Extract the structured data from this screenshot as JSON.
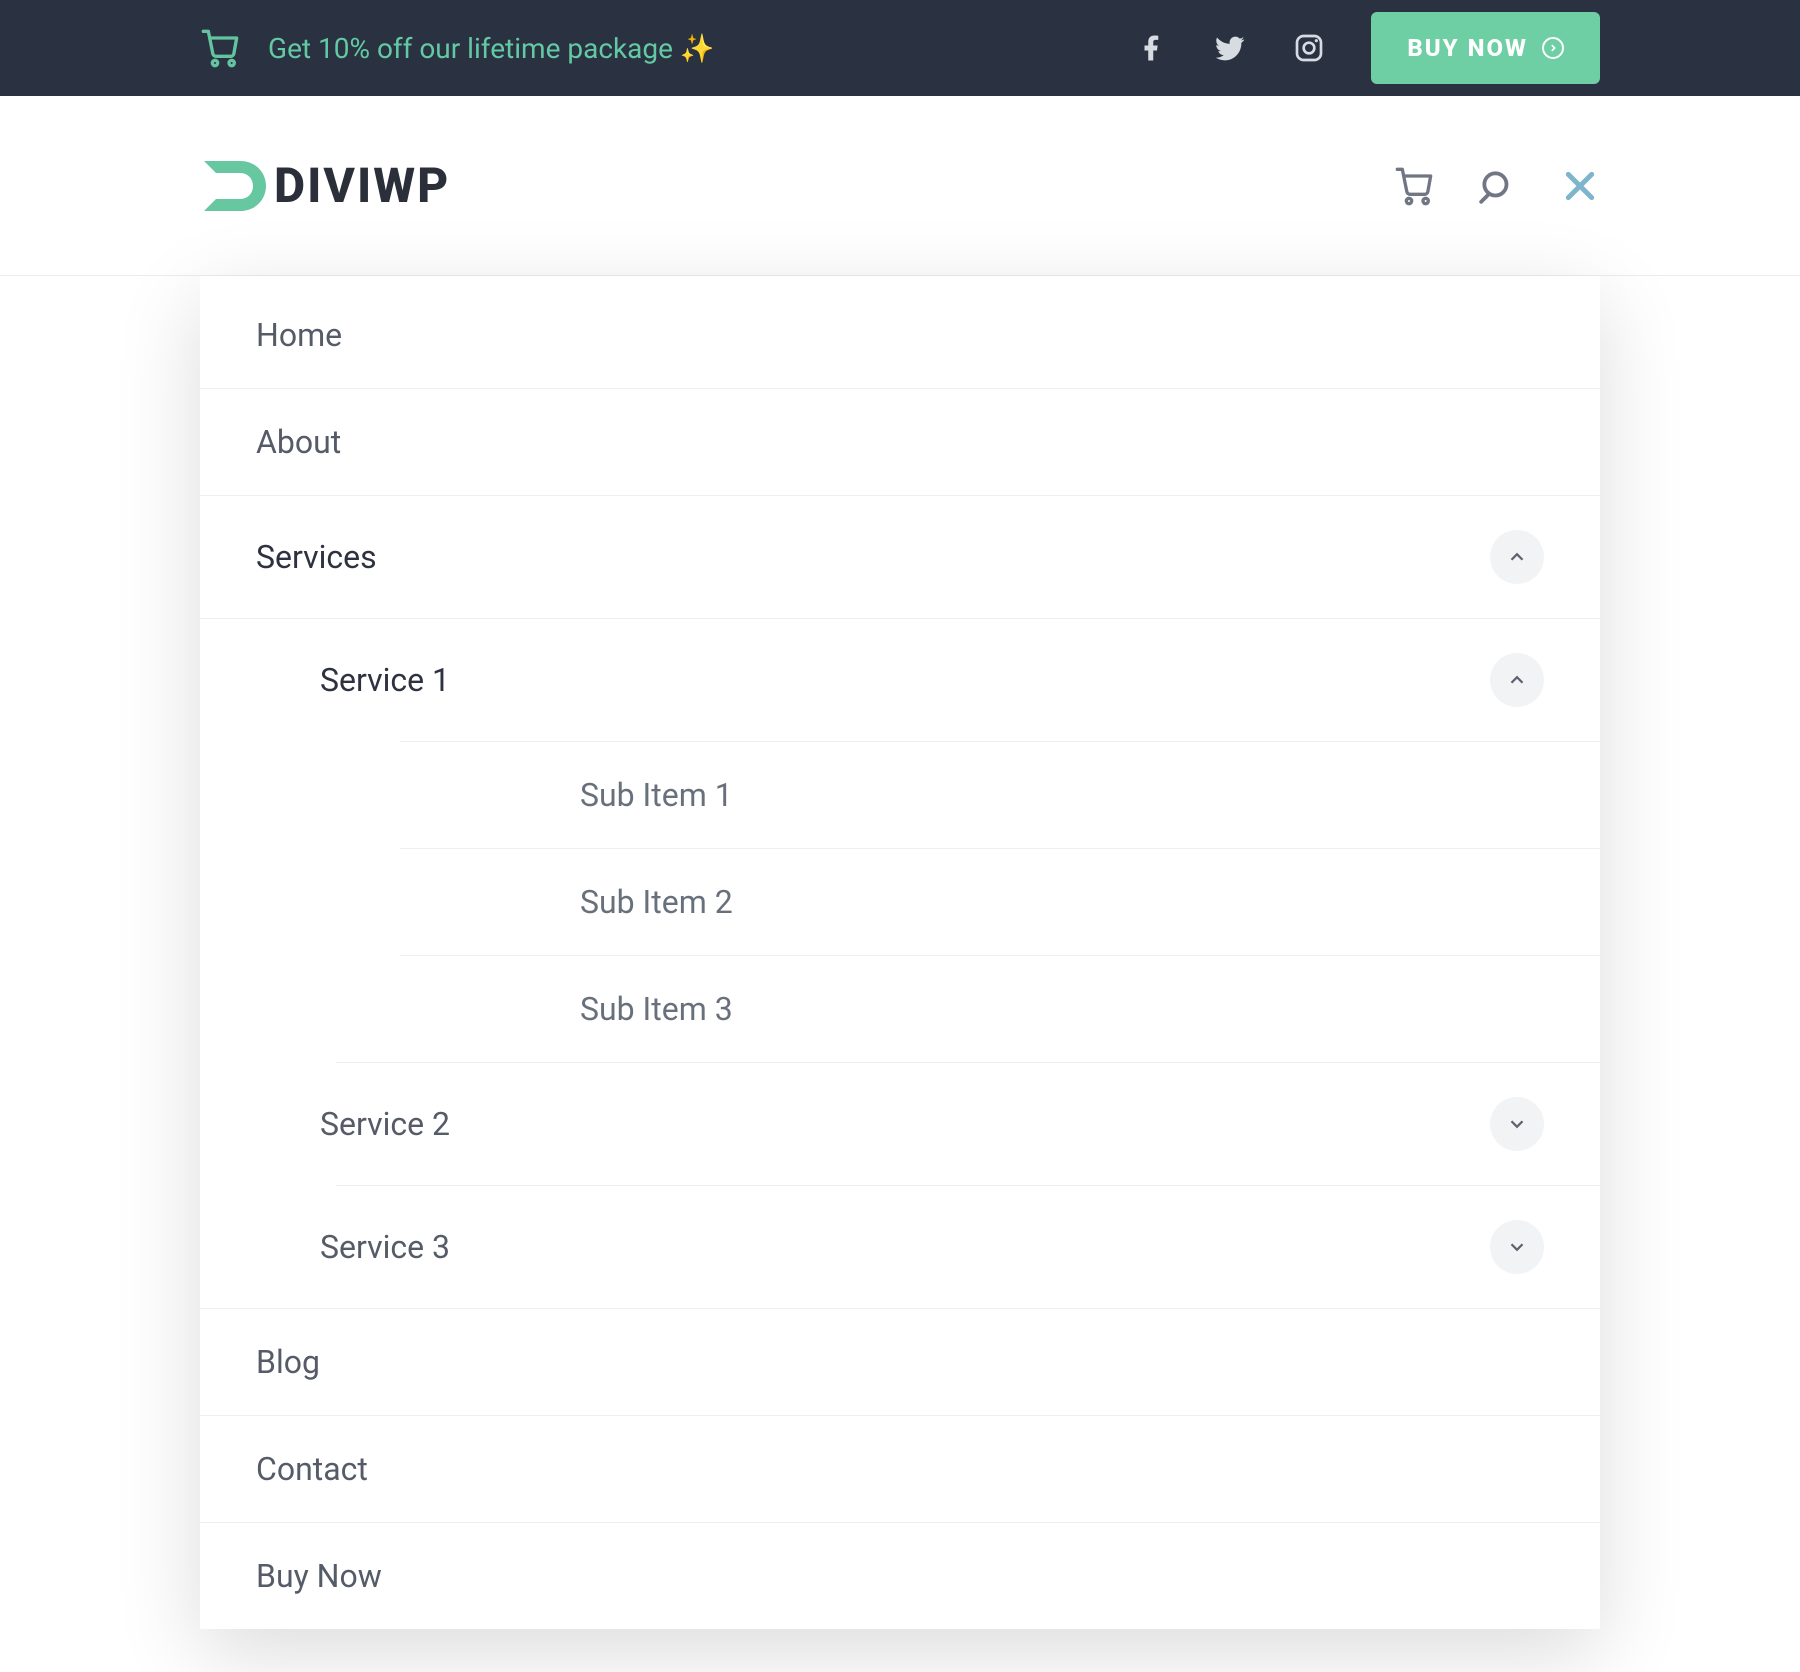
{
  "colors": {
    "accent_green": "#6ecfa5",
    "dark_navy": "#2a3140",
    "close_blue": "#7eb5cc",
    "text_gray": "#555b67"
  },
  "promo": {
    "text": "Get 10% off our lifetime package ✨",
    "cta_label": "BUY NOW"
  },
  "social": {
    "facebook": "facebook-icon",
    "twitter": "twitter-icon",
    "instagram": "instagram-icon"
  },
  "brand": {
    "name": "DIVIWP"
  },
  "header": {
    "icons": {
      "cart": "cart-icon",
      "search": "search-icon",
      "close": "close-icon"
    }
  },
  "menu": {
    "items": [
      {
        "label": "Home"
      },
      {
        "label": "About"
      },
      {
        "label": "Services",
        "expanded": true,
        "children": [
          {
            "label": "Service 1",
            "expanded": true,
            "children": [
              {
                "label": "Sub Item 1"
              },
              {
                "label": "Sub Item 2"
              },
              {
                "label": "Sub Item 3"
              }
            ]
          },
          {
            "label": "Service 2",
            "expanded": false
          },
          {
            "label": "Service 3",
            "expanded": false
          }
        ]
      },
      {
        "label": "Blog"
      },
      {
        "label": "Contact"
      },
      {
        "label": "Buy Now"
      }
    ]
  }
}
